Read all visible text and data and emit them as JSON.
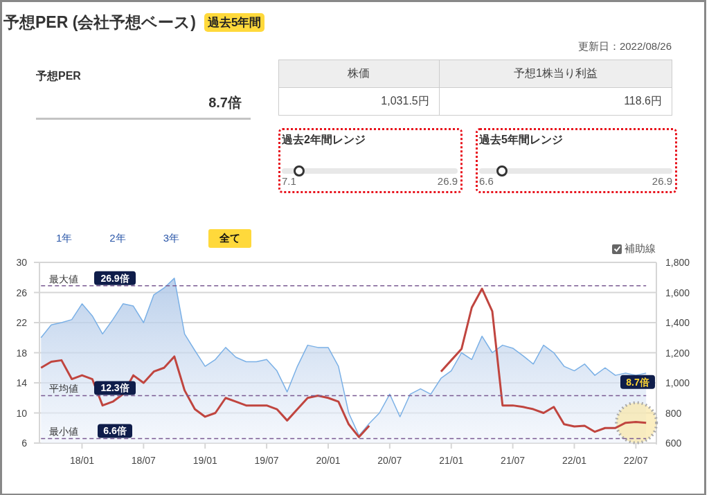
{
  "title": "予想PER (会社予想ベース)",
  "period_badge": "過去5年間",
  "updated": "更新日：2022/08/26",
  "per": {
    "label": "予想PER",
    "value": "8.7倍"
  },
  "table": {
    "columns": [
      "株価",
      "予想1株当り利益"
    ],
    "rows": [
      [
        "1,031.5円",
        "118.6円"
      ]
    ]
  },
  "ranges": [
    {
      "title": "過去2年間レンジ",
      "level": 0.08,
      "min": "7.1",
      "max": "26.9"
    },
    {
      "title": "過去5年間レンジ",
      "level": 0.1,
      "min": "6.6",
      "max": "26.9"
    }
  ],
  "tabs": [
    {
      "label": "1年",
      "selected": false
    },
    {
      "label": "2年",
      "selected": false
    },
    {
      "label": "3年",
      "selected": false
    },
    {
      "label": "全て",
      "selected": true
    }
  ],
  "guide_lines": {
    "label": "補助線",
    "checked": true
  },
  "chart_data": {
    "type": "line",
    "categories": [
      null,
      null,
      null,
      null,
      "18/01",
      null,
      null,
      null,
      null,
      null,
      "18/07",
      null,
      null,
      null,
      null,
      null,
      "19/01",
      null,
      null,
      null,
      null,
      null,
      "19/07",
      null,
      null,
      null,
      null,
      null,
      "20/01",
      null,
      null,
      null,
      null,
      null,
      "20/07",
      null,
      null,
      null,
      null,
      null,
      "21/01",
      null,
      null,
      null,
      null,
      null,
      "21/07",
      null,
      null,
      null,
      null,
      null,
      "22/01",
      null,
      null,
      null,
      null,
      null,
      "22/07",
      null
    ],
    "grid": true,
    "ylim": [
      6,
      30
    ],
    "yticks": [
      6,
      10,
      14,
      18,
      22,
      26,
      30
    ],
    "y2lim": [
      600,
      1800
    ],
    "y2ticks": [
      {
        "value": 600,
        "label": "600"
      },
      {
        "value": 800,
        "label": "800"
      },
      {
        "value": 1000,
        "label": "1,000"
      },
      {
        "value": 1200,
        "label": "1,200"
      },
      {
        "value": 1400,
        "label": "1,400"
      },
      {
        "value": 1600,
        "label": "1,600"
      },
      {
        "value": 1800,
        "label": "1,800"
      }
    ],
    "series": [
      {
        "color": "#7ab0e6",
        "axis": "y2",
        "values": [
          1300,
          1385,
          1400,
          1420,
          1525,
          1445,
          1325,
          1420,
          1525,
          1510,
          1400,
          1585,
          1630,
          1695,
          1325,
          1215,
          1110,
          1155,
          1235,
          1170,
          1140,
          1140,
          1155,
          1080,
          940,
          1110,
          1250,
          1235,
          1235,
          1110,
          800,
          650,
          730,
          800,
          925,
          775,
          925,
          960,
          925,
          1030,
          1080,
          1200,
          1155,
          1310,
          1200,
          1250,
          1230,
          1180,
          1125,
          1250,
          1200,
          1110,
          1080,
          1125,
          1050,
          1100,
          1050,
          1065,
          1050,
          1065
        ]
      },
      {
        "color": "#c0453f",
        "values": [
          16,
          16.8,
          17,
          14.5,
          15,
          14.5,
          11,
          11.5,
          12.5,
          15,
          14,
          15.5,
          16,
          17.5,
          13,
          10.5,
          9.5,
          10,
          12,
          11.5,
          11,
          11,
          11,
          10.5,
          9,
          10.5,
          12,
          12.3,
          12,
          11.5,
          8.5,
          6.8,
          8.3,
          null,
          null,
          null,
          null,
          null,
          null,
          15.5,
          17,
          18.5,
          24,
          26.5,
          23.5,
          11,
          11,
          10.8,
          10.5,
          10,
          10.8,
          8.5,
          8.2,
          8.3,
          7.5,
          8,
          8,
          8.7,
          8.8,
          8.7
        ]
      },
      {
        "color": "#7a5a92",
        "line_style": "dashed",
        "values": [
          26.9,
          26.9,
          26.9,
          26.9,
          26.9,
          26.9,
          26.9,
          26.9,
          26.9,
          26.9,
          26.9,
          26.9,
          26.9,
          26.9,
          26.9,
          26.9,
          26.9,
          26.9,
          26.9,
          26.9,
          26.9,
          26.9,
          26.9,
          26.9,
          26.9,
          26.9,
          26.9,
          26.9,
          26.9,
          26.9,
          26.9,
          26.9,
          26.9,
          26.9,
          26.9,
          26.9,
          26.9,
          26.9,
          26.9,
          26.9,
          26.9,
          26.9,
          26.9,
          26.9,
          26.9,
          26.9,
          26.9,
          26.9,
          26.9,
          26.9,
          26.9,
          26.9,
          26.9,
          26.9,
          26.9,
          26.9,
          26.9,
          26.9,
          26.9,
          26.9
        ]
      },
      {
        "color": "#7a5a92",
        "line_style": "dashed",
        "values": [
          12.3,
          12.3,
          12.3,
          12.3,
          12.3,
          12.3,
          12.3,
          12.3,
          12.3,
          12.3,
          12.3,
          12.3,
          12.3,
          12.3,
          12.3,
          12.3,
          12.3,
          12.3,
          12.3,
          12.3,
          12.3,
          12.3,
          12.3,
          12.3,
          12.3,
          12.3,
          12.3,
          12.3,
          12.3,
          12.3,
          12.3,
          12.3,
          12.3,
          12.3,
          12.3,
          12.3,
          12.3,
          12.3,
          12.3,
          12.3,
          12.3,
          12.3,
          12.3,
          12.3,
          12.3,
          12.3,
          12.3,
          12.3,
          12.3,
          12.3,
          12.3,
          12.3,
          12.3,
          12.3,
          12.3,
          12.3,
          12.3,
          12.3,
          12.3,
          12.3
        ]
      },
      {
        "color": "#7a5a92",
        "line_style": "dashed",
        "values": [
          6.6,
          6.6,
          6.6,
          6.6,
          6.6,
          6.6,
          6.6,
          6.6,
          6.6,
          6.6,
          6.6,
          6.6,
          6.6,
          6.6,
          6.6,
          6.6,
          6.6,
          6.6,
          6.6,
          6.6,
          6.6,
          6.6,
          6.6,
          6.6,
          6.6,
          6.6,
          6.6,
          6.6,
          6.6,
          6.6,
          6.6,
          6.6,
          6.6,
          6.6,
          6.6,
          6.6,
          6.6,
          6.6,
          6.6,
          6.6,
          6.6,
          6.6,
          6.6,
          6.6,
          6.6,
          6.6,
          6.6,
          6.6,
          6.6,
          6.6,
          6.6,
          6.6,
          6.6,
          6.6,
          6.6,
          6.6,
          6.6,
          6.6,
          6.6,
          6.6
        ]
      }
    ],
    "annotations": [
      "最大値",
      "26.9倍",
      "平均値",
      "12.3倍",
      "最小値",
      "6.6倍",
      "8.7倍"
    ]
  }
}
